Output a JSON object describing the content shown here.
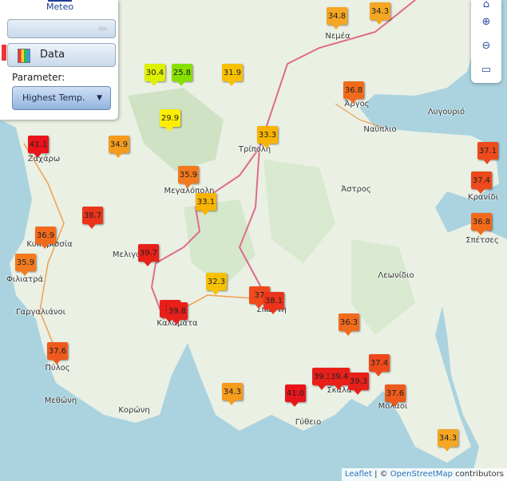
{
  "brand": {
    "logo_text": "Meteo"
  },
  "panel": {
    "data_label": "Data",
    "parameter_label": "Parameter:",
    "parameter_value": "Highest Temp."
  },
  "places": [
    {
      "name": "Νεμέα"
    },
    {
      "name": "Άργος"
    },
    {
      "name": "Ναύπλιο"
    },
    {
      "name": "Λυγουριό"
    },
    {
      "name": "Τρίπολη"
    },
    {
      "name": "Ζαχάρω"
    },
    {
      "name": "Μεγαλόπολη"
    },
    {
      "name": "Κρανίδι"
    },
    {
      "name": "Άστρος"
    },
    {
      "name": "Σπέτσες"
    },
    {
      "name": "Κυπαρισσία"
    },
    {
      "name": "Φιλιατρά"
    },
    {
      "name": "Μελιγαλάς"
    },
    {
      "name": "Λεωνίδιο"
    },
    {
      "name": "Γαργαλιάνοι"
    },
    {
      "name": "Καλαμάτα"
    },
    {
      "name": "Σπάρτη"
    },
    {
      "name": "Πύλος"
    },
    {
      "name": "Σκάλα"
    },
    {
      "name": "Μεθώνη"
    },
    {
      "name": "Μολάοι"
    },
    {
      "name": "Κορώνη"
    },
    {
      "name": "Γύθειο"
    }
  ],
  "stations": [
    {
      "value": "34.8",
      "color": "#f5a623"
    },
    {
      "value": "34.3",
      "color": "#f5a623"
    },
    {
      "value": "30.4",
      "color": "#ddf000"
    },
    {
      "value": "25.8",
      "color": "#88e000"
    },
    {
      "value": "31.9",
      "color": "#f8c000"
    },
    {
      "value": "36.8",
      "color": "#f26a1b"
    },
    {
      "value": "29.9",
      "color": "#ffee00"
    },
    {
      "value": "33.3",
      "color": "#f8b400"
    },
    {
      "value": "41.1",
      "color": "#e8141a"
    },
    {
      "value": "34.9",
      "color": "#f59b1e"
    },
    {
      "value": "37.1",
      "color": "#ee4a1c"
    },
    {
      "value": "35.9",
      "color": "#f27a1c"
    },
    {
      "value": "37.4",
      "color": "#ee4a1c"
    },
    {
      "value": "33.1",
      "color": "#f8b400"
    },
    {
      "value": "38.7",
      "color": "#ea341c"
    },
    {
      "value": "36.8",
      "color": "#f26a1b"
    },
    {
      "value": "36.9",
      "color": "#f26a1b"
    },
    {
      "value": "35.9",
      "color": "#f27a1c"
    },
    {
      "value": "39.7",
      "color": "#e8201a"
    },
    {
      "value": "32.3",
      "color": "#f8c000"
    },
    {
      "value": "37",
      "color": "#ee4a1c"
    },
    {
      "value": "38.1",
      "color": "#ea341c"
    },
    {
      "value": "39",
      "color": "#e8201a"
    },
    {
      "value": "39.8",
      "color": "#e8201a"
    },
    {
      "value": "36.3",
      "color": "#f26a1b"
    },
    {
      "value": "37.6",
      "color": "#ee5a1c"
    },
    {
      "value": "37.4",
      "color": "#ee4a1c"
    },
    {
      "value": "39.3",
      "color": "#e8201a"
    },
    {
      "value": "39.4",
      "color": "#e8201a"
    },
    {
      "value": "39.3",
      "color": "#e8201a"
    },
    {
      "value": "34.3",
      "color": "#f59b1e"
    },
    {
      "value": "41.0",
      "color": "#e8141a"
    },
    {
      "value": "37.6",
      "color": "#ee5a1c"
    },
    {
      "value": "34.3",
      "color": "#f5a623"
    }
  ],
  "attribution": {
    "leaflet": "Leaflet",
    "separator": " | © ",
    "osm": "OpenStreetMap",
    "suffix": " contributors"
  },
  "colors": {
    "sea": "#aad3df",
    "land": "#eaf0e4",
    "road": "#e06a8a"
  },
  "icons": [
    "collapse-arrow-icon",
    "chart-icon",
    "dropdown-caret-icon",
    "home-icon",
    "zoom-in-icon",
    "zoom-out-icon",
    "fullscreen-icon"
  ]
}
